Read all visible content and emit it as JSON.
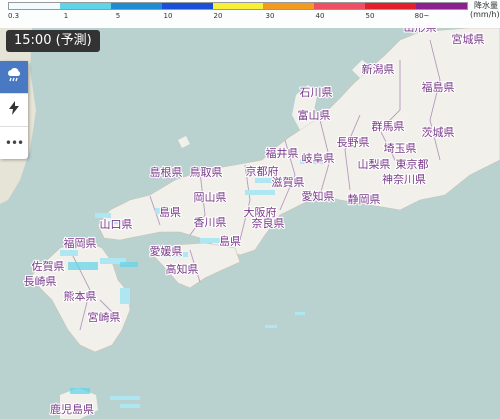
{
  "legend": {
    "ticks": [
      "0.3",
      "1",
      "5",
      "10",
      "20",
      "30",
      "40",
      "50",
      "80~"
    ],
    "colors": [
      "#f2fbfd",
      "#5fd3e8",
      "#1e8bd3",
      "#1a4fd6",
      "#f7f039",
      "#f39b20",
      "#ef4f62",
      "#e0202a",
      "#8e1f8e"
    ],
    "unit_line1": "降水量",
    "unit_line2": "(mm/h)"
  },
  "time_badge": "15:00 (予測)",
  "toolbar": {
    "buttons": [
      {
        "name": "rain-cloud-icon",
        "glyph": "☂"
      },
      {
        "name": "lightning-icon",
        "glyph": "ϟ"
      },
      {
        "name": "more-icon",
        "glyph": "•••"
      }
    ]
  },
  "map_colors": {
    "sea": "#b9d2cf",
    "land_japan": "#f2f0ea",
    "land_korea": "#e6e4d6",
    "border": "#b49ac0",
    "rain_light": "#aee6f2",
    "rain_med": "#5fd3e8"
  },
  "prefectures": [
    {
      "label": "山形県"
    },
    {
      "label": "宮城県"
    },
    {
      "label": "新潟県"
    },
    {
      "label": "石川県"
    },
    {
      "label": "福島県"
    },
    {
      "label": "富山県"
    },
    {
      "label": "群馬県"
    },
    {
      "label": "茨城県"
    },
    {
      "label": "長野県"
    },
    {
      "label": "埼玉県"
    },
    {
      "label": "福井県"
    },
    {
      "label": "岐阜県"
    },
    {
      "label": "山梨県"
    },
    {
      "label": "東京都"
    },
    {
      "label": "神奈川県"
    },
    {
      "label": "島根県"
    },
    {
      "label": "鳥取県"
    },
    {
      "label": "京都府"
    },
    {
      "label": "滋賀県"
    },
    {
      "label": "愛知県"
    },
    {
      "label": "静岡県"
    },
    {
      "label": "岡山県"
    },
    {
      "label": "大阪府"
    },
    {
      "label": "山口県"
    },
    {
      "label": "島県"
    },
    {
      "label": "香川県"
    },
    {
      "label": "奈良県"
    },
    {
      "label": "福岡県"
    },
    {
      "label": "愛媛県"
    },
    {
      "label": "島県"
    },
    {
      "label": "佐賀県"
    },
    {
      "label": "高知県"
    },
    {
      "label": "長崎県"
    },
    {
      "label": "熊本県"
    },
    {
      "label": "宮崎県"
    },
    {
      "label": "鹿児島県"
    }
  ]
}
